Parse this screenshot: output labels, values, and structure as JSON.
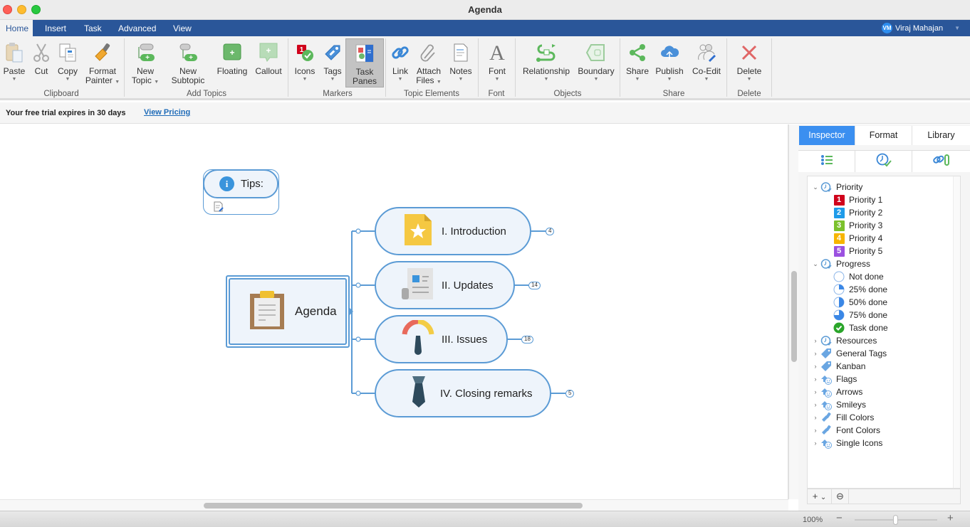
{
  "window": {
    "title": "Agenda"
  },
  "menu_tabs": [
    {
      "label": "Home",
      "active": true
    },
    {
      "label": "Insert",
      "active": false
    },
    {
      "label": "Task",
      "active": false
    },
    {
      "label": "Advanced",
      "active": false
    },
    {
      "label": "View",
      "active": false
    }
  ],
  "user": {
    "initials": "VM",
    "name": "Viraj Mahajan"
  },
  "ribbon": {
    "buttons": {
      "paste": {
        "label": "Paste",
        "icon": "paste-icon"
      },
      "cut": {
        "label": "Cut",
        "icon": "scissors-icon"
      },
      "copy": {
        "label": "Copy",
        "icon": "copy-icon"
      },
      "format_painter": {
        "label1": "Format",
        "label2": "Painter",
        "icon": "paintbrush-icon"
      },
      "new_topic": {
        "label1": "New",
        "label2": "Topic",
        "icon": "new-topic-icon"
      },
      "new_subtopic": {
        "label1": "New",
        "label2": "Subtopic",
        "icon": "new-subtopic-icon"
      },
      "floating": {
        "label": "Floating",
        "icon": "floating-topic-icon"
      },
      "callout": {
        "label": "Callout",
        "icon": "callout-icon"
      },
      "icons": {
        "label": "Icons",
        "icon": "priority-icons-icon"
      },
      "tags": {
        "label": "Tags",
        "icon": "tag-icon"
      },
      "task_panes": {
        "label1": "Task",
        "label2": "Panes",
        "icon": "task-panes-icon",
        "selected": true
      },
      "link": {
        "label": "Link",
        "icon": "link-icon"
      },
      "attach_files": {
        "label1": "Attach",
        "label2": "Files",
        "icon": "paperclip-icon"
      },
      "notes": {
        "label": "Notes",
        "icon": "notes-icon"
      },
      "font": {
        "label": "Font",
        "icon": "font-icon"
      },
      "relationship": {
        "label": "Relationship",
        "icon": "relationship-icon"
      },
      "boundary": {
        "label": "Boundary",
        "icon": "boundary-icon"
      },
      "share": {
        "label": "Share",
        "icon": "share-icon"
      },
      "publish": {
        "label": "Publish",
        "icon": "cloud-upload-icon"
      },
      "co_edit": {
        "label": "Co-Edit",
        "icon": "co-edit-icon"
      },
      "delete": {
        "label": "Delete",
        "icon": "delete-x-icon"
      }
    },
    "groups": {
      "clipboard": "Clipboard",
      "add_topics": "Add Topics",
      "markers": "Markers",
      "topic_elements": "Topic Elements",
      "font": "Font",
      "objects": "Objects",
      "share": "Share",
      "delete": "Delete"
    }
  },
  "trial": {
    "message": "Your free trial expires in 30 days",
    "link": "View Pricing"
  },
  "mindmap": {
    "tips": {
      "label": "Tips:"
    },
    "central": {
      "label": "Agenda"
    },
    "topics": [
      {
        "label": "I. Introduction",
        "count": "4",
        "icon": "star-document-icon"
      },
      {
        "label": "II. Updates",
        "count": "14",
        "icon": "newspaper-icon"
      },
      {
        "label": "III. Issues",
        "count": "18",
        "icon": "gauge-icon"
      },
      {
        "label": "IV. Closing remarks",
        "count": "5",
        "icon": "necktie-icon"
      }
    ]
  },
  "panel": {
    "tabs": [
      {
        "label": "Inspector",
        "active": true
      },
      {
        "label": "Format",
        "active": false
      },
      {
        "label": "Library",
        "active": false
      }
    ],
    "tree": {
      "priority": {
        "label": "Priority",
        "items": [
          {
            "label": "Priority 1",
            "num": "1",
            "color": "#d0021b"
          },
          {
            "label": "Priority 2",
            "num": "2",
            "color": "#1e9be9"
          },
          {
            "label": "Priority 3",
            "num": "3",
            "color": "#7bc12c"
          },
          {
            "label": "Priority 4",
            "num": "4",
            "color": "#f7b500"
          },
          {
            "label": "Priority 5",
            "num": "5",
            "color": "#9b51e0"
          }
        ]
      },
      "progress": {
        "label": "Progress",
        "items": [
          {
            "label": "Not done",
            "fraction": 0
          },
          {
            "label": "25% done",
            "fraction": 0.25
          },
          {
            "label": "50% done",
            "fraction": 0.5
          },
          {
            "label": "75% done",
            "fraction": 0.75
          },
          {
            "label": "Task done",
            "fraction": 1
          }
        ]
      },
      "collapsed": [
        {
          "label": "Resources",
          "icon": "clock-icon"
        },
        {
          "label": "General Tags",
          "icon": "tag-icon"
        },
        {
          "label": "Kanban",
          "icon": "tag-icon"
        },
        {
          "label": "Flags",
          "icon": "icon-set-icon"
        },
        {
          "label": "Arrows",
          "icon": "icon-set-icon"
        },
        {
          "label": "Smileys",
          "icon": "icon-set-icon"
        },
        {
          "label": "Fill Colors",
          "icon": "brush-icon"
        },
        {
          "label": "Font Colors",
          "icon": "brush-icon"
        },
        {
          "label": "Single Icons",
          "icon": "icon-set-icon"
        }
      ]
    },
    "tools": {
      "add": "+",
      "add_caret": "⌄",
      "remove": "⊖"
    }
  },
  "status": {
    "zoom": "100%",
    "zoom_level": 0.5
  }
}
